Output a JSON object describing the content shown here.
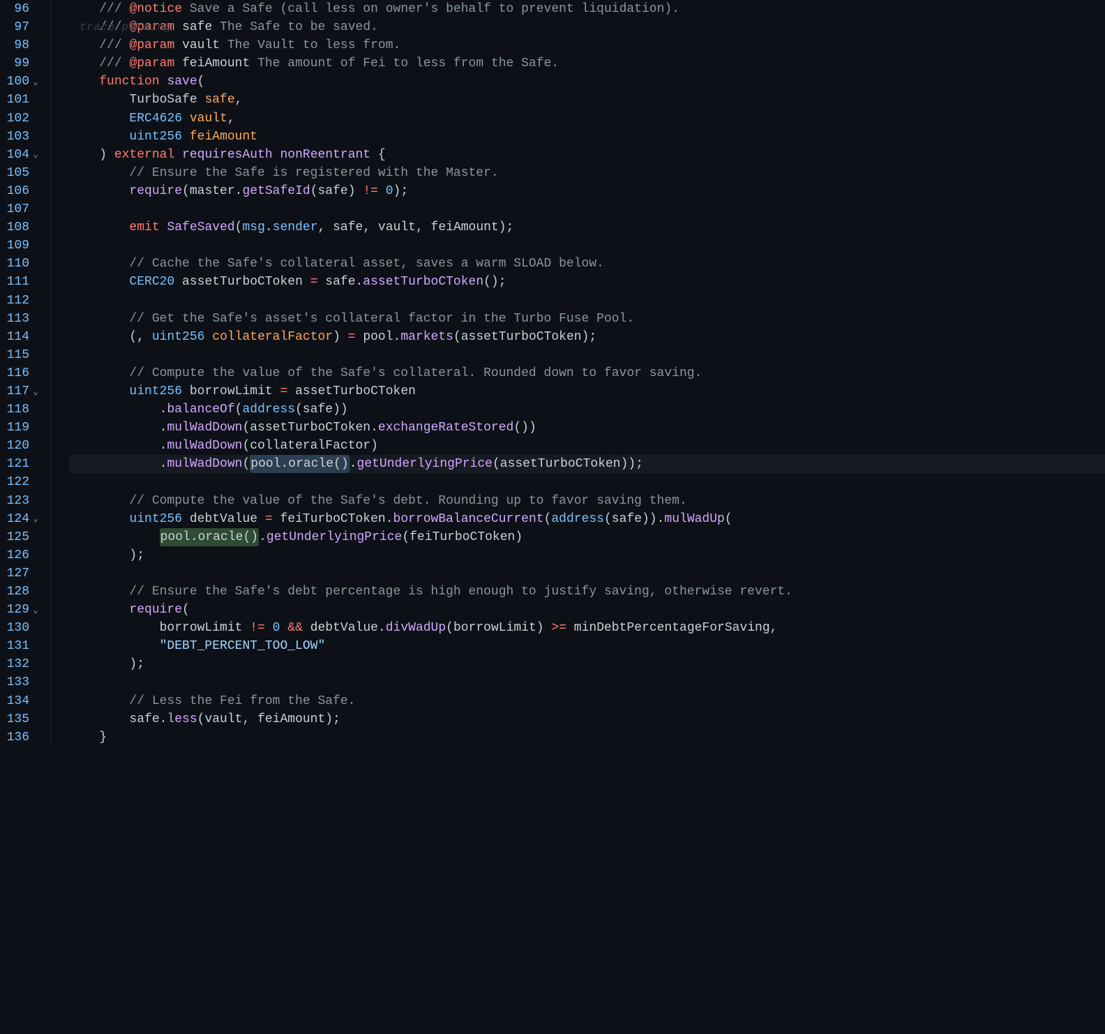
{
  "watermark": "trace parsing",
  "gutter": {
    "start": 96,
    "end": 136,
    "fold_lines": [
      100,
      104,
      117,
      124,
      129
    ],
    "highlighted_line": 121,
    "fold_glyph": "⌄"
  },
  "code": {
    "lines": [
      [
        {
          "t": "    ",
          "c": "pn"
        },
        {
          "t": "/// ",
          "c": "c"
        },
        {
          "t": "@notice",
          "c": "tag"
        },
        {
          "t": " Save a Safe (call less on owner's behalf to prevent liquidation).",
          "c": "c"
        }
      ],
      [
        {
          "t": "    ",
          "c": "pn"
        },
        {
          "t": "/// ",
          "c": "c"
        },
        {
          "t": "@param",
          "c": "tag"
        },
        {
          "t": " ",
          "c": "c"
        },
        {
          "t": "safe",
          "c": "id"
        },
        {
          "t": " The Safe to be saved.",
          "c": "c"
        }
      ],
      [
        {
          "t": "    ",
          "c": "pn"
        },
        {
          "t": "/// ",
          "c": "c"
        },
        {
          "t": "@param",
          "c": "tag"
        },
        {
          "t": " ",
          "c": "c"
        },
        {
          "t": "vault",
          "c": "id"
        },
        {
          "t": " The Vault to less from.",
          "c": "c"
        }
      ],
      [
        {
          "t": "    ",
          "c": "pn"
        },
        {
          "t": "/// ",
          "c": "c"
        },
        {
          "t": "@param",
          "c": "tag"
        },
        {
          "t": " ",
          "c": "c"
        },
        {
          "t": "feiAmount",
          "c": "id"
        },
        {
          "t": " The amount of Fei to less from the Safe.",
          "c": "c"
        }
      ],
      [
        {
          "t": "    ",
          "c": "pn"
        },
        {
          "t": "function",
          "c": "kw"
        },
        {
          "t": " ",
          "c": "pn"
        },
        {
          "t": "save",
          "c": "fn"
        },
        {
          "t": "(",
          "c": "pn"
        }
      ],
      [
        {
          "t": "        ",
          "c": "pn"
        },
        {
          "t": "TurboSafe",
          "c": "id"
        },
        {
          "t": " ",
          "c": "pn"
        },
        {
          "t": "safe",
          "c": "var"
        },
        {
          "t": ",",
          "c": "pn"
        }
      ],
      [
        {
          "t": "        ",
          "c": "pn"
        },
        {
          "t": "ERC4626",
          "c": "ty"
        },
        {
          "t": " ",
          "c": "pn"
        },
        {
          "t": "vault",
          "c": "var"
        },
        {
          "t": ",",
          "c": "pn"
        }
      ],
      [
        {
          "t": "        ",
          "c": "pn"
        },
        {
          "t": "uint256",
          "c": "ty"
        },
        {
          "t": " ",
          "c": "pn"
        },
        {
          "t": "feiAmount",
          "c": "var"
        }
      ],
      [
        {
          "t": "    ) ",
          "c": "pn"
        },
        {
          "t": "external",
          "c": "kw"
        },
        {
          "t": " ",
          "c": "pn"
        },
        {
          "t": "requiresAuth",
          "c": "fn"
        },
        {
          "t": " ",
          "c": "pn"
        },
        {
          "t": "nonReentrant",
          "c": "fn"
        },
        {
          "t": " {",
          "c": "pn"
        }
      ],
      [
        {
          "t": "        ",
          "c": "pn"
        },
        {
          "t": "// Ensure the Safe is registered with the Master.",
          "c": "c"
        }
      ],
      [
        {
          "t": "        ",
          "c": "pn"
        },
        {
          "t": "require",
          "c": "fn"
        },
        {
          "t": "(master.",
          "c": "pn"
        },
        {
          "t": "getSafeId",
          "c": "fn"
        },
        {
          "t": "(safe) ",
          "c": "pn"
        },
        {
          "t": "!=",
          "c": "op"
        },
        {
          "t": " ",
          "c": "pn"
        },
        {
          "t": "0",
          "c": "num"
        },
        {
          "t": ");",
          "c": "pn"
        }
      ],
      [],
      [
        {
          "t": "        ",
          "c": "pn"
        },
        {
          "t": "emit",
          "c": "kw"
        },
        {
          "t": " ",
          "c": "pn"
        },
        {
          "t": "SafeSaved",
          "c": "fn"
        },
        {
          "t": "(",
          "c": "pn"
        },
        {
          "t": "msg",
          "c": "ty"
        },
        {
          "t": ".",
          "c": "pn"
        },
        {
          "t": "sender",
          "c": "ty"
        },
        {
          "t": ", safe, vault, feiAmount);",
          "c": "pn"
        }
      ],
      [],
      [
        {
          "t": "        ",
          "c": "pn"
        },
        {
          "t": "// Cache the Safe's collateral asset, saves a warm SLOAD below.",
          "c": "c"
        }
      ],
      [
        {
          "t": "        ",
          "c": "pn"
        },
        {
          "t": "CERC20",
          "c": "ty"
        },
        {
          "t": " assetTurboCToken ",
          "c": "pn"
        },
        {
          "t": "=",
          "c": "op"
        },
        {
          "t": " safe.",
          "c": "pn"
        },
        {
          "t": "assetTurboCToken",
          "c": "fn"
        },
        {
          "t": "();",
          "c": "pn"
        }
      ],
      [],
      [
        {
          "t": "        ",
          "c": "pn"
        },
        {
          "t": "// Get the Safe's asset's collateral factor in the Turbo Fuse Pool.",
          "c": "c"
        }
      ],
      [
        {
          "t": "        (, ",
          "c": "pn"
        },
        {
          "t": "uint256",
          "c": "ty"
        },
        {
          "t": " ",
          "c": "pn"
        },
        {
          "t": "collateralFactor",
          "c": "var"
        },
        {
          "t": ") ",
          "c": "pn"
        },
        {
          "t": "=",
          "c": "op"
        },
        {
          "t": " pool.",
          "c": "pn"
        },
        {
          "t": "markets",
          "c": "fn"
        },
        {
          "t": "(assetTurboCToken);",
          "c": "pn"
        }
      ],
      [],
      [
        {
          "t": "        ",
          "c": "pn"
        },
        {
          "t": "// Compute the value of the Safe's collateral. Rounded down to favor saving.",
          "c": "c"
        }
      ],
      [
        {
          "t": "        ",
          "c": "pn"
        },
        {
          "t": "uint256",
          "c": "ty"
        },
        {
          "t": " borrowLimit ",
          "c": "pn"
        },
        {
          "t": "=",
          "c": "op"
        },
        {
          "t": " assetTurboCToken",
          "c": "pn"
        }
      ],
      [
        {
          "t": "            .",
          "c": "pn"
        },
        {
          "t": "balanceOf",
          "c": "fn"
        },
        {
          "t": "(",
          "c": "pn"
        },
        {
          "t": "address",
          "c": "ty"
        },
        {
          "t": "(safe))",
          "c": "pn"
        }
      ],
      [
        {
          "t": "            .",
          "c": "pn"
        },
        {
          "t": "mulWadDown",
          "c": "fn"
        },
        {
          "t": "(assetTurboCToken.",
          "c": "pn"
        },
        {
          "t": "exchangeRateStored",
          "c": "fn"
        },
        {
          "t": "())",
          "c": "pn"
        }
      ],
      [
        {
          "t": "            .",
          "c": "pn"
        },
        {
          "t": "mulWadDown",
          "c": "fn"
        },
        {
          "t": "(collateralFactor)",
          "c": "pn"
        }
      ],
      [
        {
          "t": "            .",
          "c": "pn"
        },
        {
          "t": "mulWadDown",
          "c": "fn"
        },
        {
          "t": "(",
          "c": "pn"
        },
        {
          "t": "pool.oracle()",
          "c": "sel1"
        },
        {
          "t": ".",
          "c": "pn"
        },
        {
          "t": "getUnderlyingPrice",
          "c": "fn"
        },
        {
          "t": "(assetTurboCToken));",
          "c": "pn"
        }
      ],
      [],
      [
        {
          "t": "        ",
          "c": "pn"
        },
        {
          "t": "// Compute the value of the Safe's debt. Rounding up to favor saving them.",
          "c": "c"
        }
      ],
      [
        {
          "t": "        ",
          "c": "pn"
        },
        {
          "t": "uint256",
          "c": "ty"
        },
        {
          "t": " debtValue ",
          "c": "pn"
        },
        {
          "t": "=",
          "c": "op"
        },
        {
          "t": " feiTurboCToken.",
          "c": "pn"
        },
        {
          "t": "borrowBalanceCurrent",
          "c": "fn"
        },
        {
          "t": "(",
          "c": "pn"
        },
        {
          "t": "address",
          "c": "ty"
        },
        {
          "t": "(safe)).",
          "c": "pn"
        },
        {
          "t": "mulWadUp",
          "c": "fn"
        },
        {
          "t": "(",
          "c": "pn"
        }
      ],
      [
        {
          "t": "            ",
          "c": "pn"
        },
        {
          "t": "pool.oracle()",
          "c": "sel2"
        },
        {
          "t": ".",
          "c": "pn"
        },
        {
          "t": "getUnderlyingPrice",
          "c": "fn"
        },
        {
          "t": "(feiTurboCToken)",
          "c": "pn"
        }
      ],
      [
        {
          "t": "        );",
          "c": "pn"
        }
      ],
      [],
      [
        {
          "t": "        ",
          "c": "pn"
        },
        {
          "t": "// Ensure the Safe's debt percentage is high enough to justify saving, otherwise revert.",
          "c": "c"
        }
      ],
      [
        {
          "t": "        ",
          "c": "pn"
        },
        {
          "t": "require",
          "c": "fn"
        },
        {
          "t": "(",
          "c": "pn"
        }
      ],
      [
        {
          "t": "            borrowLimit ",
          "c": "pn"
        },
        {
          "t": "!=",
          "c": "op"
        },
        {
          "t": " ",
          "c": "pn"
        },
        {
          "t": "0",
          "c": "num"
        },
        {
          "t": " ",
          "c": "pn"
        },
        {
          "t": "&&",
          "c": "op"
        },
        {
          "t": " debtValue.",
          "c": "pn"
        },
        {
          "t": "divWadUp",
          "c": "fn"
        },
        {
          "t": "(borrowLimit) ",
          "c": "pn"
        },
        {
          "t": ">=",
          "c": "op"
        },
        {
          "t": " minDebtPercentageForSaving,",
          "c": "pn"
        }
      ],
      [
        {
          "t": "            ",
          "c": "pn"
        },
        {
          "t": "\"DEBT_PERCENT_TOO_LOW\"",
          "c": "str"
        }
      ],
      [
        {
          "t": "        );",
          "c": "pn"
        }
      ],
      [],
      [
        {
          "t": "        ",
          "c": "pn"
        },
        {
          "t": "// Less the Fei from the Safe.",
          "c": "c"
        }
      ],
      [
        {
          "t": "        safe.",
          "c": "pn"
        },
        {
          "t": "less",
          "c": "fn"
        },
        {
          "t": "(vault, feiAmount);",
          "c": "pn"
        }
      ],
      [
        {
          "t": "    }",
          "c": "pn"
        }
      ]
    ]
  }
}
